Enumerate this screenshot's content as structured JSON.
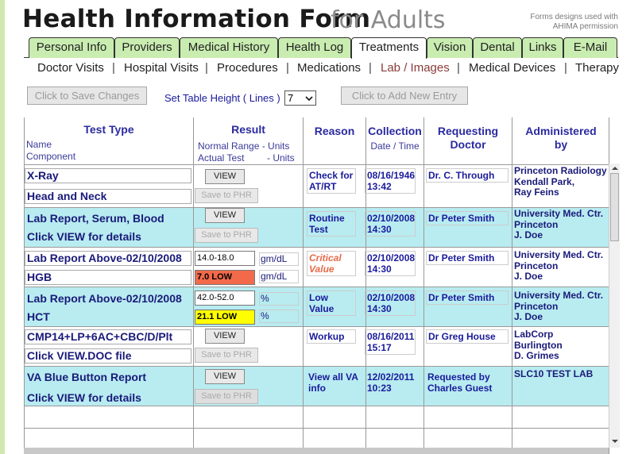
{
  "header": {
    "title_main": "Health Information Form",
    "title_sub": "for Adults",
    "credit_line1": "Forms designs used with",
    "credit_line2": "AHIMA permission"
  },
  "tabs": [
    "Personal Info",
    "Providers",
    "Medical History",
    "Health Log",
    "Treatments",
    "Vision",
    "Dental",
    "Links",
    "E-Mail"
  ],
  "active_tab": "Treatments",
  "subnav": [
    "Doctor Visits",
    "Hospital Visits",
    "Procedures",
    "Medications",
    "Lab / Images",
    "Medical Devices",
    "Therapy"
  ],
  "active_subnav": "Lab / Images",
  "toolbar": {
    "save_label": "Click to Save Changes",
    "height_label": "Set Table Height ( Lines )",
    "height_value": "7",
    "add_label": "Click to Add New Entry"
  },
  "columns": {
    "test_type": "Test Type",
    "test_name": "Name",
    "test_component": "Component",
    "result": "Result",
    "result_normal": "Normal Range - Units",
    "result_actual": "Actual Test",
    "result_units": "- Units",
    "reason": "Reason",
    "collection": "Collection",
    "collection_dt": "Date / Time",
    "requesting": "Requesting",
    "requesting2": "Doctor",
    "administered": "Administered",
    "administered2": "by"
  },
  "rows": [
    {
      "name": "X-Ray",
      "component": "Head and Neck",
      "view": "VIEW",
      "save": "Save to PHR",
      "reason": "Check for AT/RT",
      "date": "08/16/1946",
      "time": "13:42",
      "doctor": "Dr. C. Through",
      "admin1": "Princeton Radiology",
      "admin2": "Kendall Park,",
      "admin3": "Ray Feins"
    },
    {
      "name": "Lab Report, Serum, Blood",
      "component": "Click VIEW for details",
      "view": "VIEW",
      "save": "Save to PHR",
      "reason": "Routine Test",
      "date": "02/10/2008",
      "time": "14:30",
      "doctor": "Dr Peter Smith",
      "admin1": "University Med. Ctr.",
      "admin2": "Princeton",
      "admin3": "J. Doe"
    },
    {
      "name": "Lab Report Above-02/10/2008",
      "component": "HGB",
      "normal": "14.0-18.0",
      "normal_unit": "gm/dL",
      "actual": "7.0   LOW",
      "actual_unit": "gm/dL",
      "actual_color": "#f26a4a",
      "reason": "Critical Value",
      "date": "02/10/2008",
      "time": "14:30",
      "doctor": "Dr Peter Smith",
      "admin1": "University Med. Ctr.",
      "admin2": "Princeton",
      "admin3": "J. Doe"
    },
    {
      "name": "Lab Report Above-02/10/2008",
      "component": "HCT",
      "normal": "42.0-52.0",
      "normal_unit": "%",
      "actual": "21.1   LOW",
      "actual_unit": "%",
      "actual_color": "#ffff00",
      "reason": "Low Value",
      "date": "02/10/2008",
      "time": "14:30",
      "doctor": "Dr Peter Smith",
      "admin1": "University Med. Ctr.",
      "admin2": "Princeton",
      "admin3": "J. Doe"
    },
    {
      "name": "CMP14+LP+6AC+CBC/D/Plt",
      "component": "Click VIEW.DOC file",
      "view": "VIEW",
      "save": "Save to PHR",
      "reason": "Workup",
      "date": "08/16/2011",
      "time": "15:17",
      "doctor": "Dr Greg House",
      "admin1": "LabCorp",
      "admin2": "Burlington",
      "admin3": "D. Grimes"
    },
    {
      "name": "VA Blue Button Report",
      "component": "Click VIEW for details",
      "view": "VIEW",
      "save": "Save to PHR",
      "reason": "View all VA info",
      "date": "12/02/2011",
      "time": "10:23",
      "doctor": "Requested by Charles Guest",
      "admin1": "SLC10 TEST LAB",
      "admin2": "",
      "admin3": ""
    }
  ]
}
